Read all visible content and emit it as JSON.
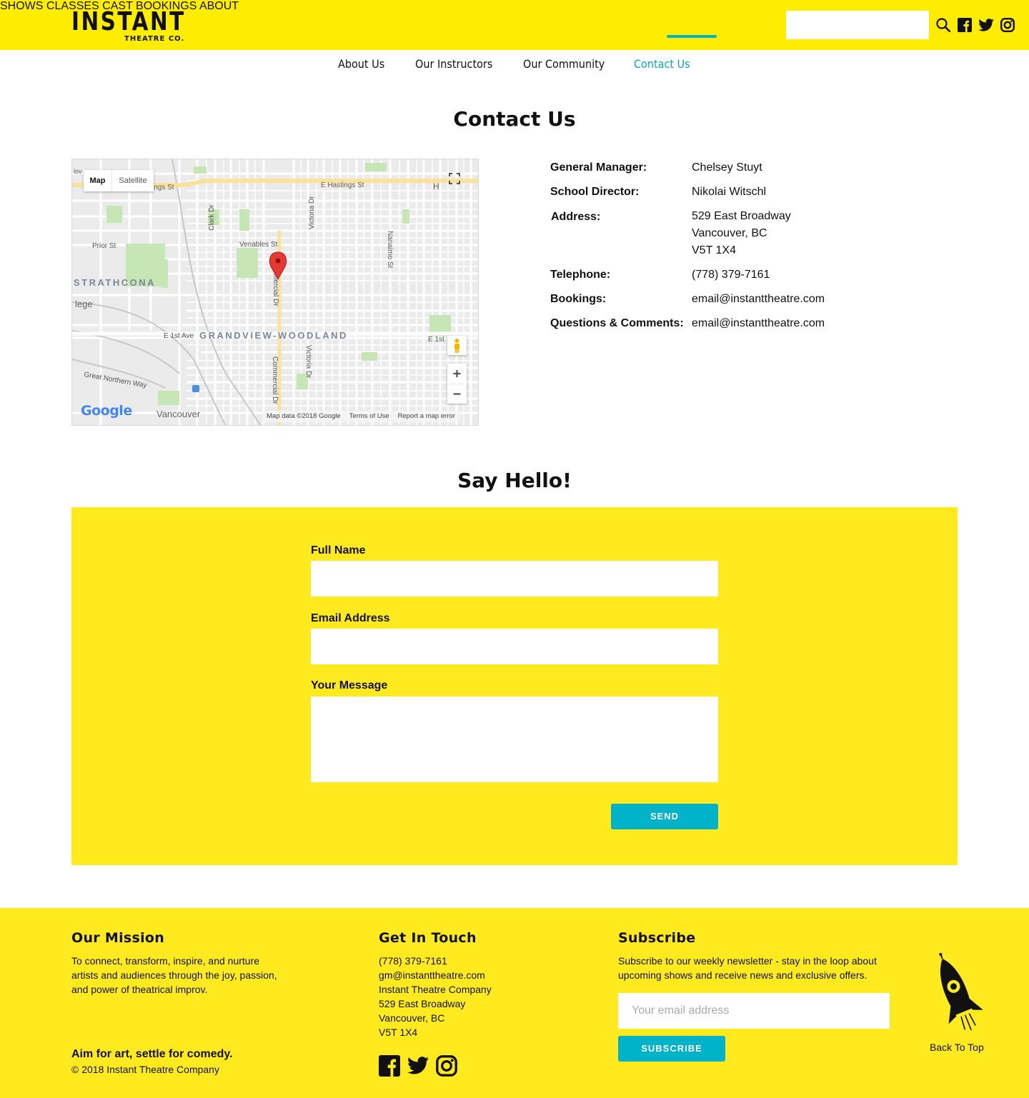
{
  "brand": {
    "name": "INSTANT",
    "sub": "THEATRE CO."
  },
  "nav": {
    "items": [
      {
        "label": "SHOWS"
      },
      {
        "label": "CLASSES"
      },
      {
        "label": "CAST"
      },
      {
        "label": "BOOKINGS"
      },
      {
        "label": "ABOUT"
      }
    ],
    "active": "ABOUT"
  },
  "subnav": {
    "items": [
      {
        "label": "About Us"
      },
      {
        "label": "Our Instructors"
      },
      {
        "label": "Our Community"
      },
      {
        "label": "Contact Us"
      }
    ],
    "active": "Contact Us"
  },
  "page": {
    "title": "Contact Us",
    "form_title": "Say Hello!"
  },
  "map": {
    "tab_map": "Map",
    "tab_satellite": "Satellite",
    "streets": {
      "hastings": "E Hastings St",
      "hastings_left": "ings St",
      "clark": "Clark Dr",
      "victoria_top": "Victoria Dr",
      "nanaimo": "Nanaimo St",
      "prior": "Prior St",
      "venables": "Venables St",
      "commercial_top": "mercial Dr",
      "commercial_bottom": "Commercial Dr",
      "first_ave": "E 1st Ave",
      "first_right": "E 1st",
      "victoria_bottom": "Victoria Dr",
      "great_northern": "Great Northern Way",
      "lege": "lege",
      "vancouver": "Vancouver",
      "h_partial": "H",
      "lov": "lov"
    },
    "neighbourhoods": {
      "strathcona": "STRATHCONA",
      "grandview": "GRANDVIEW-WOODLAND"
    },
    "attribution": {
      "data": "Map data ©2018 Google",
      "terms": "Terms of Use",
      "report": "Report a map error",
      "logo": "Google"
    }
  },
  "contact": {
    "rows": [
      {
        "label": "General Manager:",
        "value": "Chelsey Stuyt"
      },
      {
        "label": "School Director:",
        "value": "Nikolai Witschl"
      },
      {
        "label": "Address:",
        "lines": [
          "529 East Broadway",
          "Vancouver, BC",
          "V5T 1X4"
        ]
      },
      {
        "label": "Telephone:",
        "value": "(778) 379-7161"
      },
      {
        "label": "Bookings:",
        "value": "email@instanttheatre.com"
      },
      {
        "label": "Questions & Comments:",
        "value": "email@instanttheatre.com"
      }
    ]
  },
  "form": {
    "full_name_label": "Full Name",
    "email_label": "Email Address",
    "message_label": "Your Message",
    "send_label": "SEND"
  },
  "footer": {
    "mission": {
      "title": "Our Mission",
      "lines": [
        "To connect, transform, inspire, and nurture",
        "artists and audiences through the joy, passion,",
        "and power of theatrical improv."
      ],
      "tagline": "Aim for art, settle for comedy.",
      "copyright": "© 2018 Instant Theatre Company"
    },
    "touch": {
      "title": "Get In Touch",
      "lines": [
        "(778) 379-7161",
        "gm@instanttheatre.com",
        "Instant Theatre Company",
        "529 East Broadway",
        "Vancouver, BC",
        "V5T 1X4"
      ]
    },
    "subscribe": {
      "title": "Subscribe",
      "lines": [
        "Subscribe to our weekly newsletter - stay in the loop about",
        "upcoming shows and receive news and exclusive offers."
      ],
      "placeholder": "Your email address",
      "button": "SUBSCRIBE"
    },
    "back_to_top": "Back To Top"
  },
  "colors": {
    "brand_yellow": "#ffed00",
    "accent": "#00b3c9",
    "map_pin": "#e53935"
  },
  "icons": [
    "search-icon",
    "facebook-icon",
    "twitter-icon",
    "instagram-icon",
    "rocket-icon",
    "map-pin-icon",
    "fullscreen-icon",
    "pegman-icon",
    "zoom-in-icon",
    "zoom-out-icon"
  ]
}
